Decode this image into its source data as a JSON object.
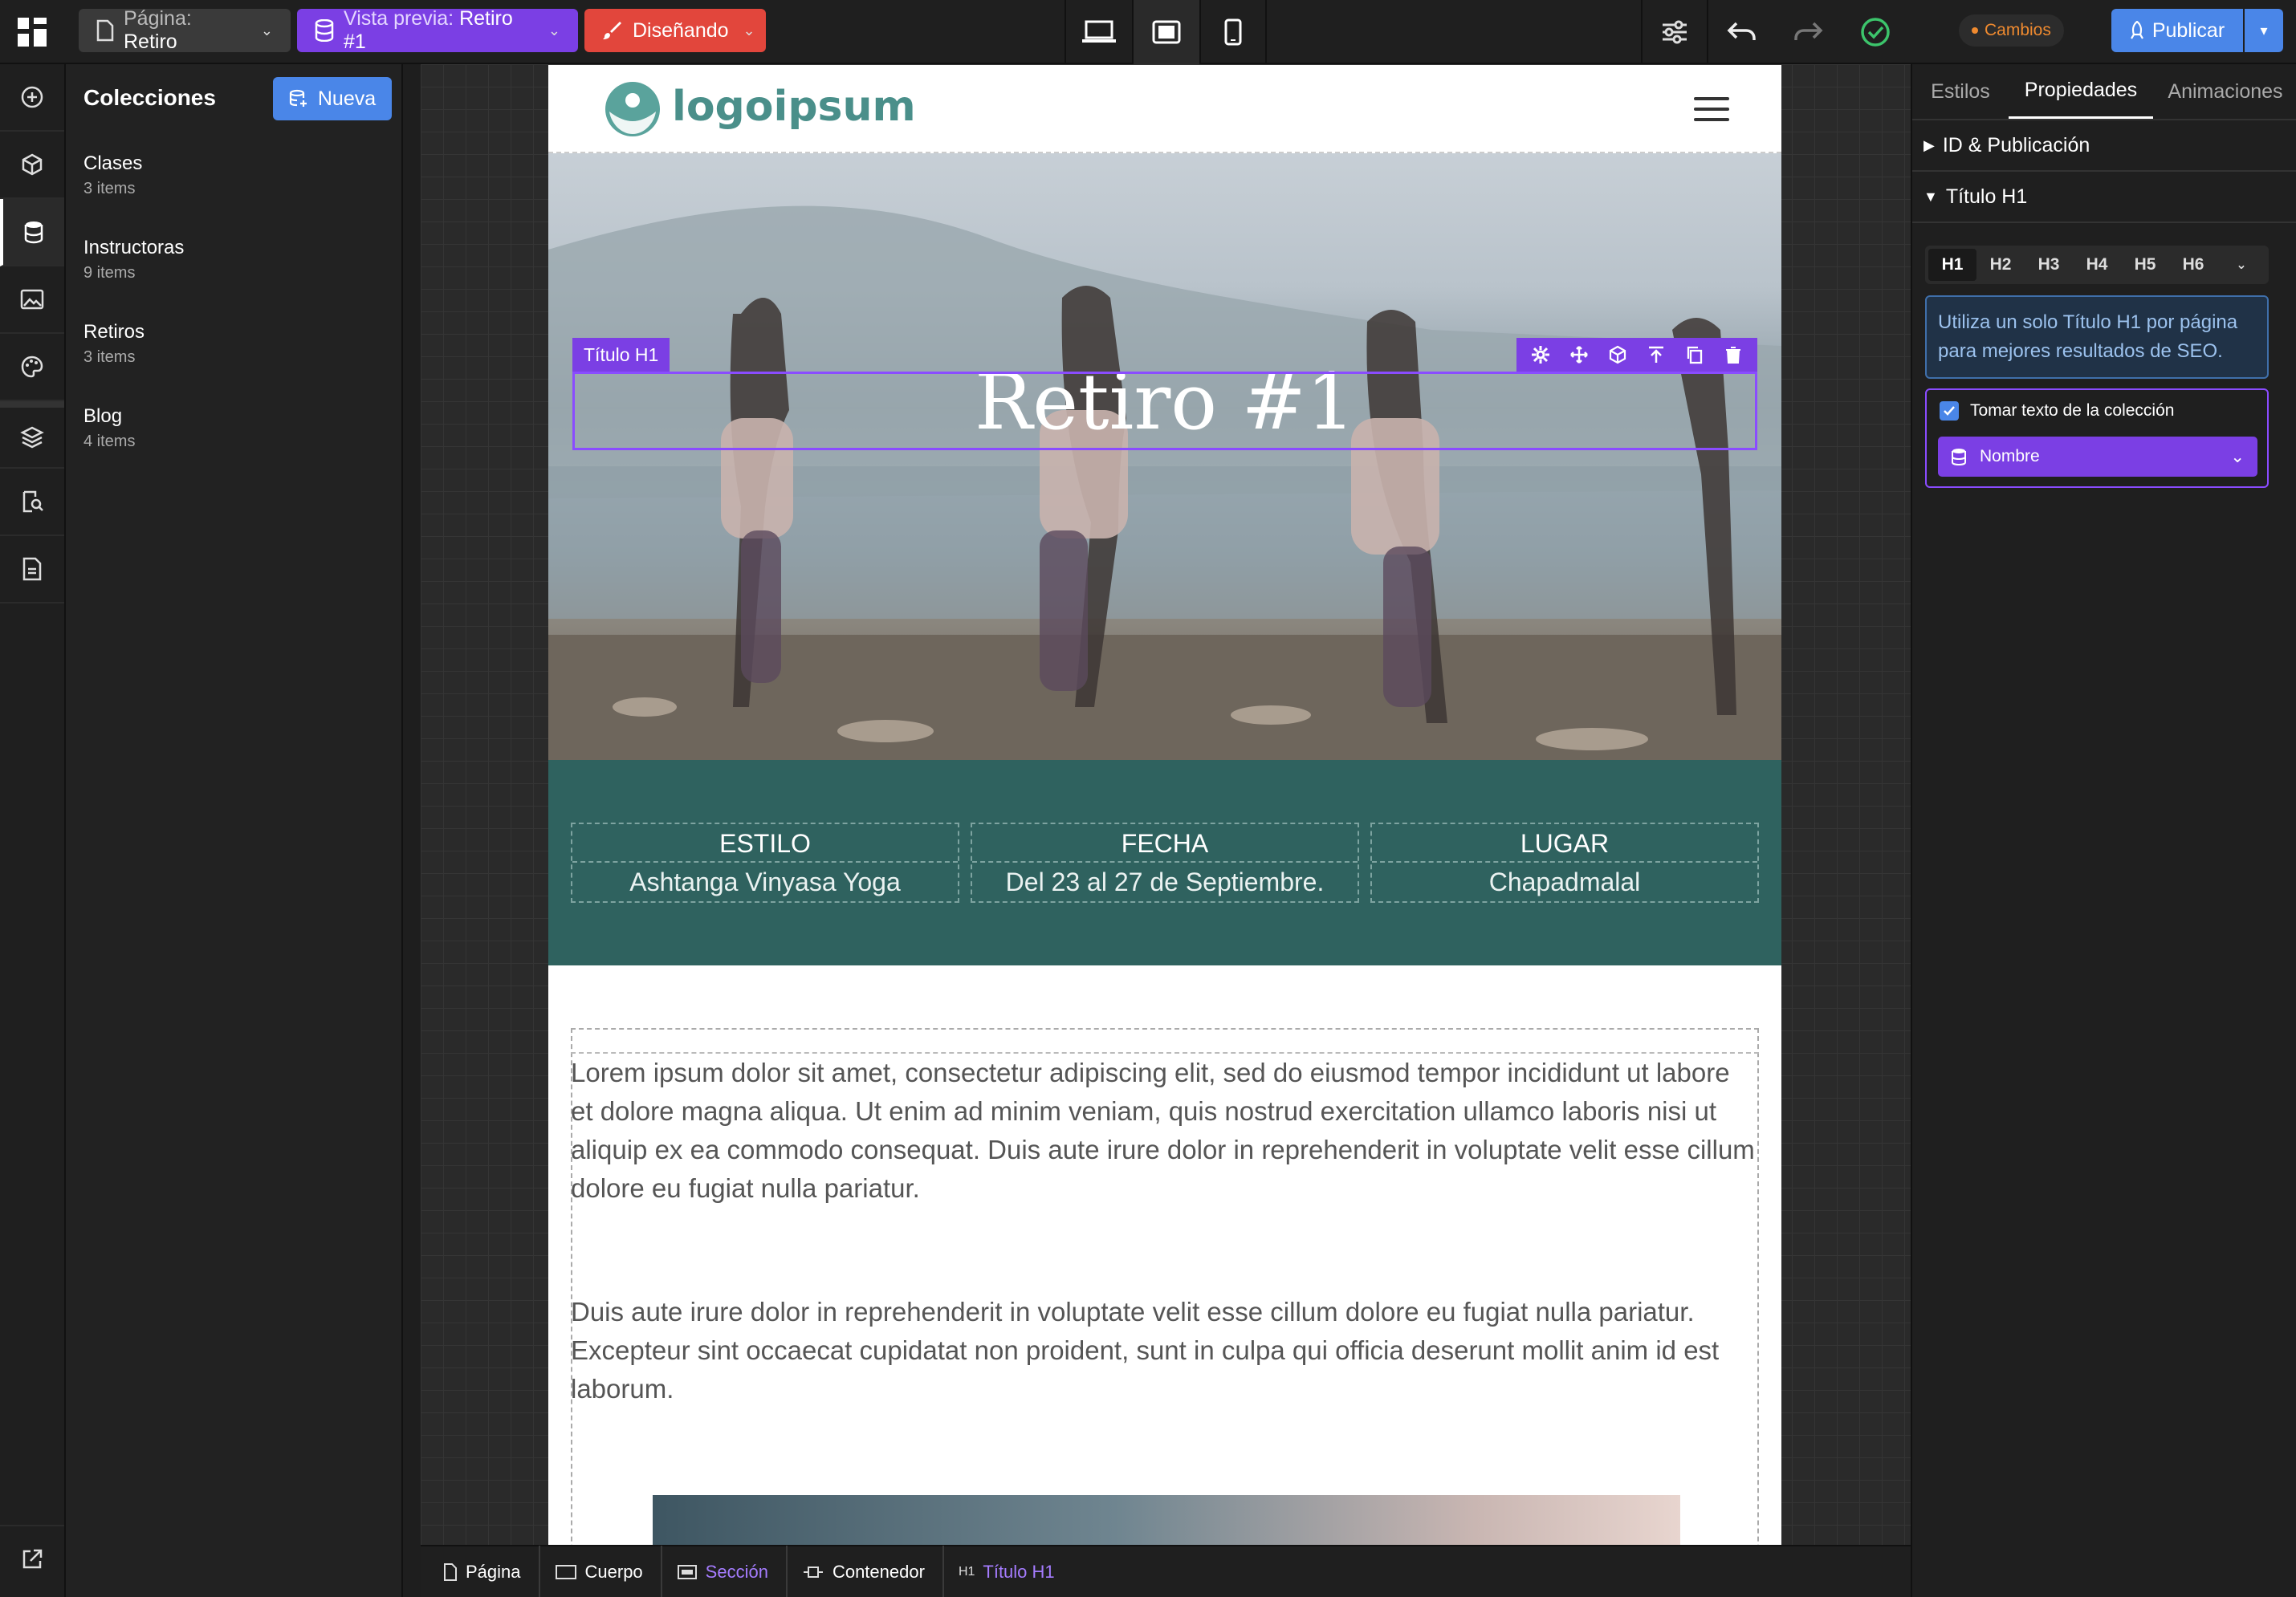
{
  "topbar": {
    "page_prefix": "Página:",
    "page_name": "Retiro",
    "preview_prefix": "Vista previa:",
    "preview_name": "Retiro #1",
    "mode": "Diseñando",
    "changes_label": "Cambios",
    "publish_label": "Publicar"
  },
  "colors": {
    "preview_purple": "#7b3fe4",
    "design_red": "#e2463c",
    "publish_blue": "#4a86e8",
    "changes_orange": "#ef8a2f",
    "ok_green": "#3cc46b",
    "band_teal": "#2f625f"
  },
  "collections": {
    "title": "Colecciones",
    "new_label": "Nueva",
    "items": [
      {
        "name": "Clases",
        "count": "3 items"
      },
      {
        "name": "Instructoras",
        "count": "9 items"
      },
      {
        "name": "Retiros",
        "count": "3 items"
      },
      {
        "name": "Blog",
        "count": "4 items"
      }
    ]
  },
  "rail_icons": [
    "add-icon",
    "box-icon",
    "database-icon",
    "image-icon",
    "palette-icon",
    "layers-icon",
    "search-page-icon",
    "document-icon",
    "external-link-icon"
  ],
  "site": {
    "logo_text": "logoipsum",
    "hero_title": "Retiro #1",
    "selection_label": "Título H1",
    "info": [
      {
        "label": "ESTILO",
        "value": "Ashtanga Vinyasa Yoga"
      },
      {
        "label": "FECHA",
        "value": "Del 23 al 27 de Septiembre."
      },
      {
        "label": "LUGAR",
        "value": "Chapadmalal"
      }
    ],
    "paragraph1": "Lorem ipsum dolor sit amet, consectetur adipiscing elit, sed do eiusmod tempor incididunt ut labore et dolore magna aliqua. Ut enim ad minim veniam, quis nostrud exercitation ullamco laboris nisi ut aliquip ex ea commodo consequat. Duis aute irure dolor in reprehenderit in voluptate velit esse cillum dolore eu fugiat nulla pariatur.",
    "paragraph2": "Duis aute irure dolor in reprehenderit in voluptate velit esse cillum dolore eu fugiat nulla pariatur. Excepteur sint occaecat cupidatat non proident, sunt in culpa qui officia deserunt mollit anim id est laborum."
  },
  "breadcrumb": [
    {
      "label": "Página"
    },
    {
      "label": "Cuerpo"
    },
    {
      "label": "Sección"
    },
    {
      "label": "Contenedor"
    },
    {
      "label": "Título H1"
    }
  ],
  "right_panel": {
    "tabs": [
      "Estilos",
      "Propiedades",
      "Animaciones"
    ],
    "active_tab": "Propiedades",
    "section_id": "ID & Publicación",
    "section_heading": "Título H1",
    "heading_levels": [
      "H1",
      "H2",
      "H3",
      "H4",
      "H5",
      "H6"
    ],
    "seo_note": "Utiliza un solo Título H1 por página para mejores resultados de SEO.",
    "collection_checkbox_label": "Tomar texto de la colección",
    "collection_field": "Nombre"
  }
}
